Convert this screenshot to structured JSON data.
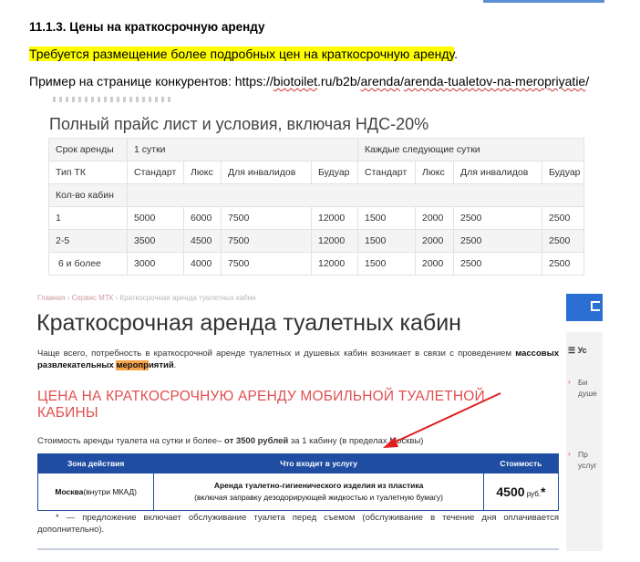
{
  "doc": {
    "heading": "11.1.3. Цены на краткосрочную аренду",
    "requirement": "Требуется размещение более подробных цен на краткосрочную аренду",
    "requirement_end": ".",
    "example_prefix": "Пример на странице конкурентов: ",
    "example_url_parts": [
      "https://",
      "biotoilet",
      ".ru/b2b/",
      "arenda",
      "/",
      "arenda-tualetov-na-meropriyatie",
      "/"
    ]
  },
  "price_list": {
    "title": "Полный прайс лист и условия, включая НДС-20%",
    "row_period": {
      "label": "Срок аренды",
      "one_day": "1 сутки",
      "next_days": "Каждые следующие сутки"
    },
    "row_types": [
      "Тип ТК",
      "Стандарт",
      "Люкс",
      "Для инвалидов",
      "Будуар",
      "Стандарт",
      "Люкс",
      "Для инвалидов",
      "Будуар"
    ],
    "row_count_label": "Кол-во кабин",
    "rows": [
      [
        "1",
        "5000",
        "6000",
        "7500",
        "12000",
        "1500",
        "2000",
        "2500",
        "2500"
      ],
      [
        "2-5",
        "3500",
        "4500",
        "7500",
        "12000",
        "1500",
        "2000",
        "2500",
        "2500"
      ],
      [
        " 6 и более",
        "3000",
        "4000",
        "7500",
        "12000",
        "1500",
        "2000",
        "2500",
        "2500"
      ]
    ]
  },
  "site": {
    "breadcrumbs": {
      "home": "Главная",
      "sep": " › ",
      "service": "Сервис МТК",
      "current": "Краткосрочная аренда туалетных кабин"
    },
    "title": "Краткосрочная аренда туалетных кабин",
    "intro_1": "Чаще всего, потребность в краткосрочной аренде туалетных и душевых кабин возникает в связи с проведением ",
    "intro_bold_1": "массовых развлекательных ",
    "intro_mark": "меропр",
    "intro_bold_2": "иятий",
    "intro_end": ".",
    "section_heading": "ЦЕНА НА КРАТКОСРОЧНУЮ АРЕНДУ МОБИЛЬНОЙ ТУАЛЕТНОЙ КАБИНЫ",
    "cost_prefix": "Стоимость аренды туалета на сутки и более– ",
    "cost_bold": "от 3500 рублей",
    "cost_suffix": " за 1 кабину (в пределах Москвы)",
    "table": {
      "headers": [
        "Зона действия",
        "Что входит в услугу",
        "Стоимость"
      ],
      "zone_bold": "Москва",
      "zone_rest": "(внутри МКАД)",
      "service_bold": "Аренда туалетно-гигиенического изделия из пластика",
      "service_rest": "(включая заправку дезодорирующей жидкостью и туалетную бумагу)",
      "price": "4500",
      "price_unit": " руб.",
      "price_star": "*"
    },
    "note": "* — предложение включает обслуживание туалета перед съемом (обслуживание в течение дня оплачивается дополнительно).",
    "sidebar": {
      "head": "Ус",
      "item1_line1": "Би",
      "item1_line2": "душе",
      "item2_line1": "Пр",
      "item2_line2": "услуг"
    }
  },
  "colors": {
    "highlight": "#ffff00",
    "accent_red": "#e05050",
    "table_blue": "#1e4da1",
    "arrow": "#e02020"
  }
}
